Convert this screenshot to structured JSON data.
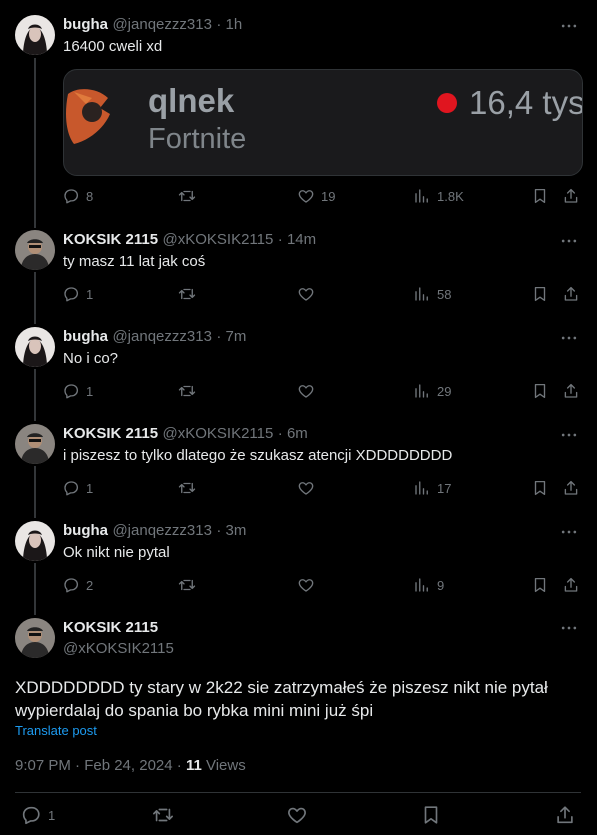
{
  "replies": [
    {
      "name": "bugha",
      "handle": "@janqezzz313",
      "time": "1h",
      "text": "16400 cweli xd",
      "counts": {
        "reply": "8",
        "retweet": "",
        "like": "19",
        "views": "1.8K"
      }
    },
    {
      "name": "KOKSIK 2115",
      "handle": "@xKOKSIK2115",
      "time": "14m",
      "text": "ty masz 11 lat jak coś",
      "counts": {
        "reply": "1",
        "retweet": "",
        "like": "",
        "views": "58"
      }
    },
    {
      "name": "bugha",
      "handle": "@janqezzz313",
      "time": "7m",
      "text": "No i co?",
      "counts": {
        "reply": "1",
        "retweet": "",
        "like": "",
        "views": "29"
      }
    },
    {
      "name": "KOKSIK 2115",
      "handle": "@xKOKSIK2115",
      "time": "6m",
      "text": "i piszesz to tylko dlatego że szukasz atencji XDDDDDDDD",
      "counts": {
        "reply": "1",
        "retweet": "",
        "like": "",
        "views": "17"
      }
    },
    {
      "name": "bugha",
      "handle": "@janqezzz313",
      "time": "3m",
      "text": "Ok nikt nie pytal",
      "counts": {
        "reply": "2",
        "retweet": "",
        "like": "",
        "views": "9"
      }
    }
  ],
  "embed": {
    "streamer": "qlnek",
    "game": "Fortnite",
    "viewers": "16,4 tys"
  },
  "main": {
    "name": "KOKSIK 2115",
    "handle": "@xKOKSIK2115",
    "text_line1": "XDDDDDDDD ty stary w 2k22 sie zatrzymałeś że piszesz nikt nie pytał",
    "text_line2": "wypierdalaj do spania bo rybka mini mini już śpi",
    "translate": "Translate post",
    "timestamp": "9:07 PM · Feb 24, 2024 · ",
    "views_count": "11",
    "views_label": " Views",
    "reply_count": "1"
  },
  "colors": {
    "background": "#000000",
    "text": "#e7e9ea",
    "muted": "#71767b",
    "link": "#1d9bf0",
    "live": "#e0151f"
  }
}
